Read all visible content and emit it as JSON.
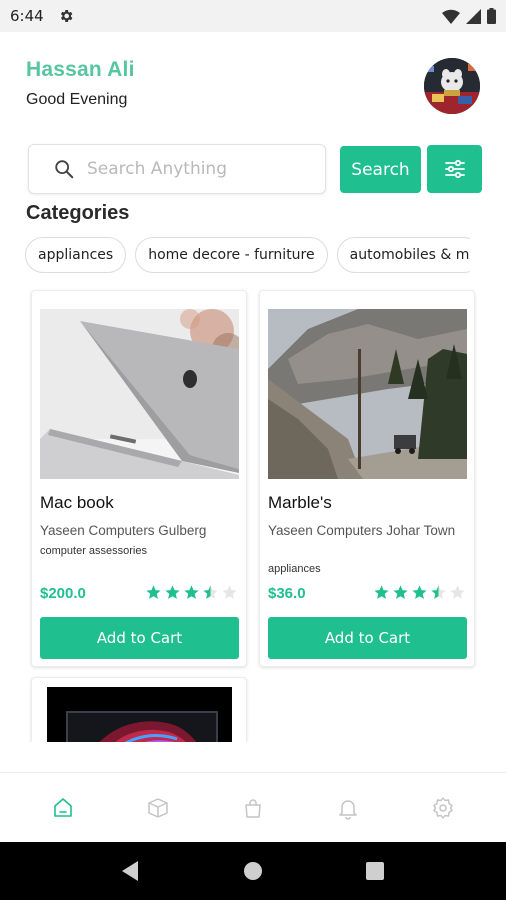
{
  "status_bar": {
    "time": "6:44"
  },
  "header": {
    "user_name": "Hassan Ali",
    "greeting": "Good Evening"
  },
  "search": {
    "placeholder": "Search Anything",
    "button_label": "Search"
  },
  "categories": {
    "title": "Categories",
    "chips": [
      "appliances",
      "home decore - furniture",
      "automobiles & m"
    ]
  },
  "products": [
    {
      "title": "Mac book",
      "store": "Yaseen Computers Gulberg",
      "category": "computer assessories",
      "price": "$200.0",
      "rating": 3.5,
      "cart_label": "Add to Cart"
    },
    {
      "title": "Marble's",
      "store": "Yaseen Computers Johar Town",
      "category": "appliances",
      "price": "$36.0",
      "rating": 3.5,
      "cart_label": "Add to Cart"
    }
  ],
  "bottom_nav": {
    "items": [
      "home-icon",
      "box-icon",
      "bag-icon",
      "bell-icon",
      "settings-icon"
    ],
    "active": "home-icon"
  },
  "colors": {
    "accent": "#1fbf8f",
    "name": "#57c6a0",
    "star_empty": "#e6e6e6"
  }
}
